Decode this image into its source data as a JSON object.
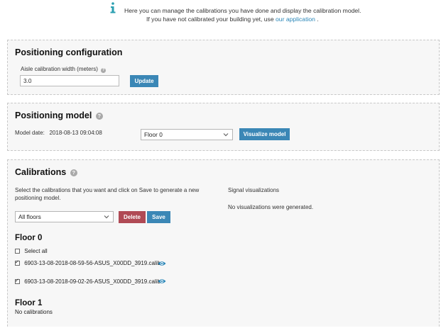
{
  "info": {
    "icon": "info-icon",
    "line1": "Here you can manage the calibrations you have done and display the calibration model.",
    "line2_prefix": "If you have not calibrated your building yet, use",
    "line2_link": "our application",
    "line2_suffix": "."
  },
  "positioning_config": {
    "title": "Positioning configuration",
    "field_label": "Aisle calibration width (meters)",
    "field_value": "3.0",
    "update_label": "Update"
  },
  "positioning_model": {
    "title": "Positioning model",
    "date_label": "Model date:",
    "date_value": "2018-08-13 09:04:08",
    "floor_select": "Floor 0",
    "visualize_label": "Visualize model"
  },
  "calibrations": {
    "title": "Calibrations",
    "instructions_line1": "Select the calibrations that you want and click on Save to generate a new",
    "instructions_line2": "positioning model.",
    "filter_select": "All floors",
    "delete_label": "Delete",
    "save_label": "Save",
    "signal_title": "Signal visualizations",
    "signal_empty": "No visualizations were generated.",
    "floors": [
      {
        "name": "Floor 0",
        "select_all": "Select all",
        "items": [
          {
            "file": "6903-13-08-2018-08-59-56-ASUS_X00DD_3919.calib",
            "checked": true
          },
          {
            "file": "6903-13-08-2018-09-02-26-ASUS_X00DD_3919.calib",
            "checked": true
          }
        ]
      },
      {
        "name": "Floor 1",
        "empty": "No calibrations"
      }
    ]
  },
  "colors": {
    "accent_blue": "#3b87b6",
    "delete_red": "#b04a55",
    "link": "#2a86b8",
    "eye_icon": "#2a86b8"
  }
}
